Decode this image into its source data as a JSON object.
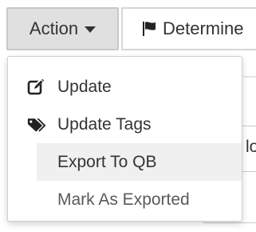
{
  "toolbar": {
    "action_label": "Action",
    "determine_label": "Determine"
  },
  "menu": {
    "items": [
      {
        "label": "Update",
        "icon": "edit-icon"
      },
      {
        "label": "Update Tags",
        "icon": "tags-icon"
      },
      {
        "label": "Export To QB",
        "icon": "",
        "highlighted": true
      },
      {
        "label": "Mark As Exported",
        "icon": ""
      }
    ]
  },
  "background": {
    "input_fragment": "lo"
  },
  "colors": {
    "button_bg": "#e0e0e0",
    "highlight_bg": "#f0f0f0",
    "text": "#333333"
  }
}
